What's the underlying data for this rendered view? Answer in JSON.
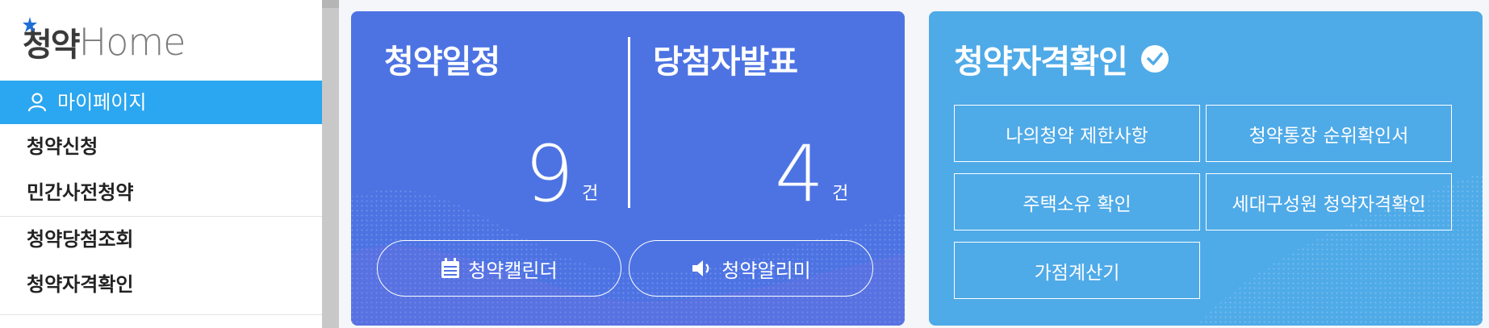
{
  "logo": {
    "ko": "청약",
    "en": "Home"
  },
  "sidebar": {
    "items": [
      {
        "label": "마이페이지",
        "active": true
      },
      {
        "label": "청약신청"
      },
      {
        "label": "민간사전청약"
      },
      {
        "label": "청약당첨조회"
      },
      {
        "label": "청약자격확인"
      }
    ]
  },
  "schedule_card": {
    "left_title": "청약일정",
    "left_count": "9",
    "left_unit": "건",
    "right_title": "당첨자발표",
    "right_count": "4",
    "right_unit": "건",
    "calendar_button": "청약캘린더",
    "alarm_button": "청약알리미",
    "calendar_icon": "calendar-icon",
    "alarm_icon": "speaker-icon",
    "color": "#4d73e3"
  },
  "eligibility_card": {
    "title": "청약자격확인",
    "title_icon": "check-circle-icon",
    "buttons": [
      "나의청약 제한사항",
      "청약통장 순위확인서",
      "주택소유 확인",
      "세대구성원 청약자격확인",
      "가점계산기"
    ],
    "color": "#4faae8"
  },
  "colors": {
    "active_menu": "#2ba6f0"
  }
}
